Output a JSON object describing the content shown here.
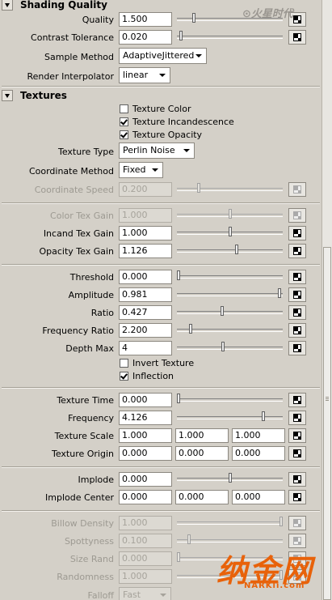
{
  "sections": {
    "shading_quality": "Shading Quality",
    "textures": "Textures"
  },
  "shading": {
    "quality": {
      "label": "Quality",
      "value": "1.500",
      "slider": 0.15
    },
    "contrast_tolerance": {
      "label": "Contrast Tolerance",
      "value": "0.020",
      "slider": 0.02
    },
    "sample_method": {
      "label": "Sample Method",
      "value": "AdaptiveJittered"
    },
    "render_interpolator": {
      "label": "Render Interpolator",
      "value": "linear"
    }
  },
  "textures": {
    "texture_color": "Texture Color",
    "texture_incandescence": "Texture Incandescence",
    "texture_opacity": "Texture Opacity",
    "texture_color_checked": false,
    "texture_incandescence_checked": true,
    "texture_opacity_checked": true,
    "texture_type": {
      "label": "Texture Type",
      "value": "Perlin Noise"
    },
    "coordinate_method": {
      "label": "Coordinate Method",
      "value": "Fixed"
    },
    "coordinate_speed": {
      "label": "Coordinate Speed",
      "value": "0.200",
      "slider": 0.2
    },
    "color_tex_gain": {
      "label": "Color Tex Gain",
      "value": "1.000",
      "slider": 0.5
    },
    "incand_tex_gain": {
      "label": "Incand Tex Gain",
      "value": "1.000",
      "slider": 0.5
    },
    "opacity_tex_gain": {
      "label": "Opacity Tex Gain",
      "value": "1.126",
      "slider": 0.563
    },
    "threshold": {
      "label": "Threshold",
      "value": "0.000",
      "slider": 0.0
    },
    "amplitude": {
      "label": "Amplitude",
      "value": "0.981",
      "slider": 0.981
    },
    "ratio": {
      "label": "Ratio",
      "value": "0.427",
      "slider": 0.427
    },
    "frequency_ratio": {
      "label": "Frequency Ratio",
      "value": "2.200",
      "slider": 0.12
    },
    "depth_max": {
      "label": "Depth Max",
      "value": "4",
      "slider": 0.43
    },
    "invert_texture": "Invert Texture",
    "invert_texture_checked": false,
    "inflection": "Inflection",
    "inflection_checked": true,
    "texture_time": {
      "label": "Texture Time",
      "value": "0.000",
      "slider": 0.0
    },
    "frequency": {
      "label": "Frequency",
      "value": "4.126",
      "slider": 0.83
    },
    "texture_scale": {
      "label": "Texture Scale",
      "values": [
        "1.000",
        "1.000",
        "1.000"
      ]
    },
    "texture_origin": {
      "label": "Texture Origin",
      "values": [
        "0.000",
        "0.000",
        "0.000"
      ]
    },
    "implode": {
      "label": "Implode",
      "value": "0.000",
      "slider": 0.5
    },
    "implode_center": {
      "label": "Implode Center",
      "values": [
        "0.000",
        "0.000",
        "0.000"
      ]
    },
    "billow_density": {
      "label": "Billow Density",
      "value": "1.000",
      "slider": 1.0
    },
    "spottyness": {
      "label": "Spottyness",
      "value": "0.100",
      "slider": 0.1
    },
    "size_rand": {
      "label": "Size Rand",
      "value": "0.000",
      "slider": 0.0
    },
    "randomness": {
      "label": "Randomness",
      "value": "1.000",
      "slider": 1.0
    },
    "falloff": {
      "label": "Falloff",
      "value": "Fast"
    }
  },
  "watermark": {
    "top": "⊙火星时代",
    "bottom": "纳金网",
    "url": "NARKii.com"
  },
  "colors": {
    "panel_bg": "#d4d0c8",
    "watermark_orange": "#e8620a"
  }
}
